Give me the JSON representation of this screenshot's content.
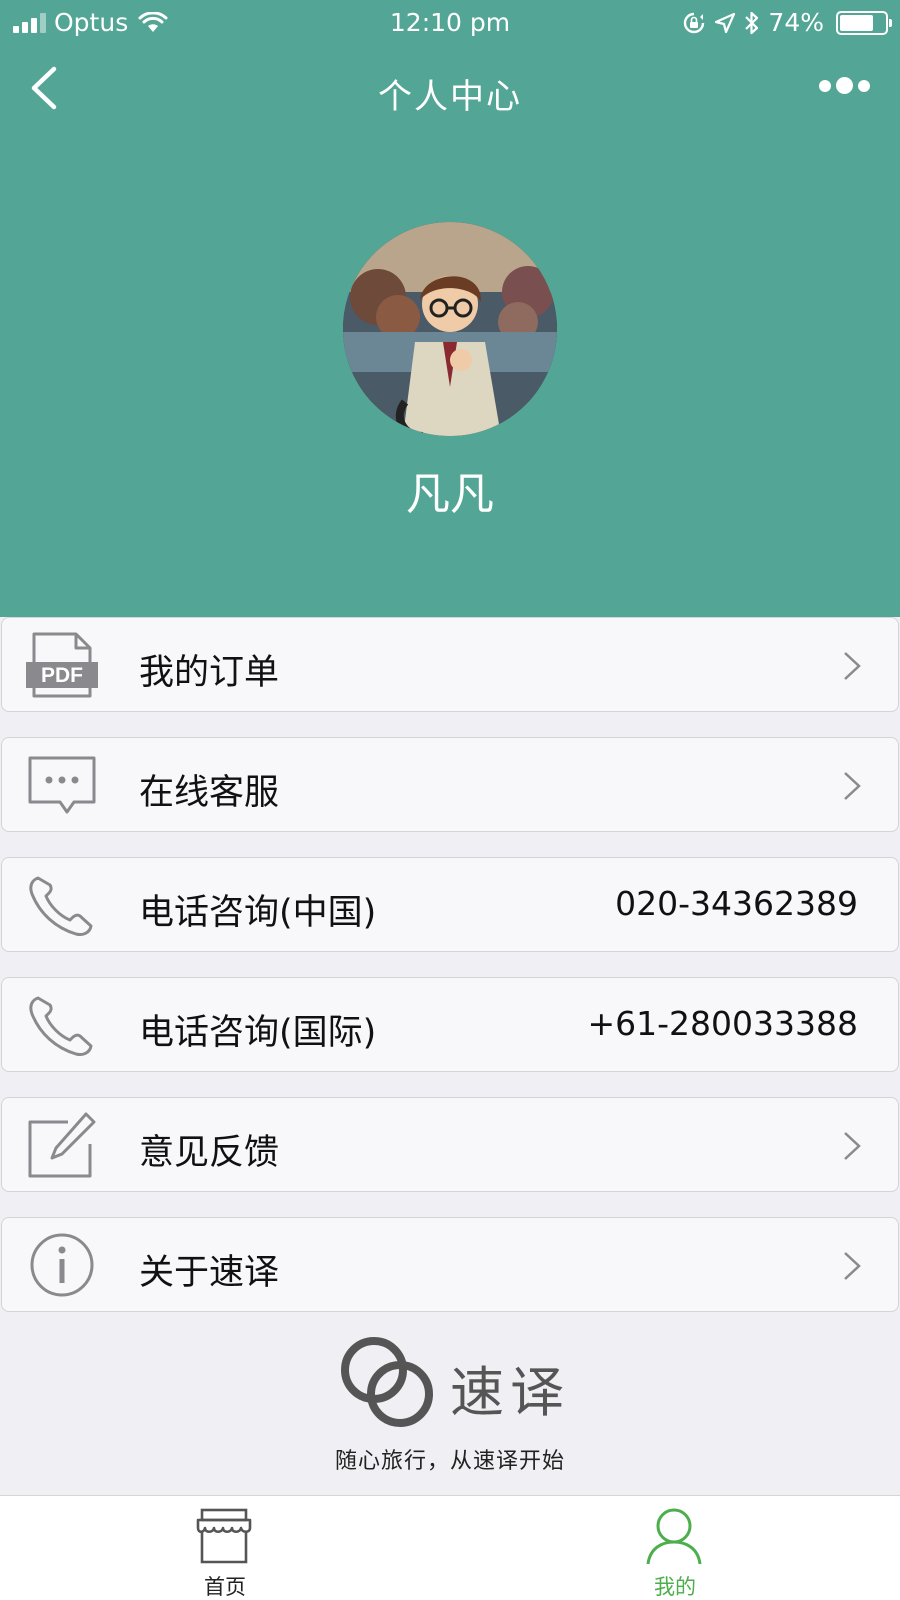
{
  "status_bar": {
    "carrier": "Optus",
    "time": "12:10 pm",
    "battery": "74%",
    "battery_level": 0.74,
    "signal_bars": 3
  },
  "nav": {
    "title": "个人中心",
    "back_icon": "chevron-left-icon",
    "more_icon": "more-dots-icon"
  },
  "profile": {
    "name": "凡凡"
  },
  "menu": {
    "items": [
      {
        "label": "我的订单",
        "icon": "pdf-document-icon",
        "pdf_text": "PDF",
        "value": "",
        "chevron": true
      },
      {
        "label": "在线客服",
        "icon": "chat-bubble-icon",
        "value": "",
        "chevron": true
      },
      {
        "label": "电话咨询(中国)",
        "icon": "phone-icon",
        "value": "020-34362389",
        "chevron": false
      },
      {
        "label": "电话咨询(国际)",
        "icon": "phone-icon",
        "value": "+61-280033388",
        "chevron": false
      },
      {
        "label": "意见反馈",
        "icon": "edit-icon",
        "value": "",
        "chevron": true
      },
      {
        "label": "关于速译",
        "icon": "info-icon",
        "value": "",
        "chevron": true
      }
    ]
  },
  "brand": {
    "name": "速译",
    "slogan": "随心旅行，从速译开始"
  },
  "tabbar": {
    "tabs": [
      {
        "label": "首页",
        "icon": "store-icon",
        "active": false
      },
      {
        "label": "我的",
        "icon": "user-icon",
        "active": true
      }
    ]
  },
  "colors": {
    "header_bg": "#53a695",
    "page_bg": "#efeff4",
    "item_bg": "#f8f7fa",
    "icon_gray": "#8a8a8e",
    "tab_active": "#4cae4c",
    "tab_inactive": "#222222"
  }
}
